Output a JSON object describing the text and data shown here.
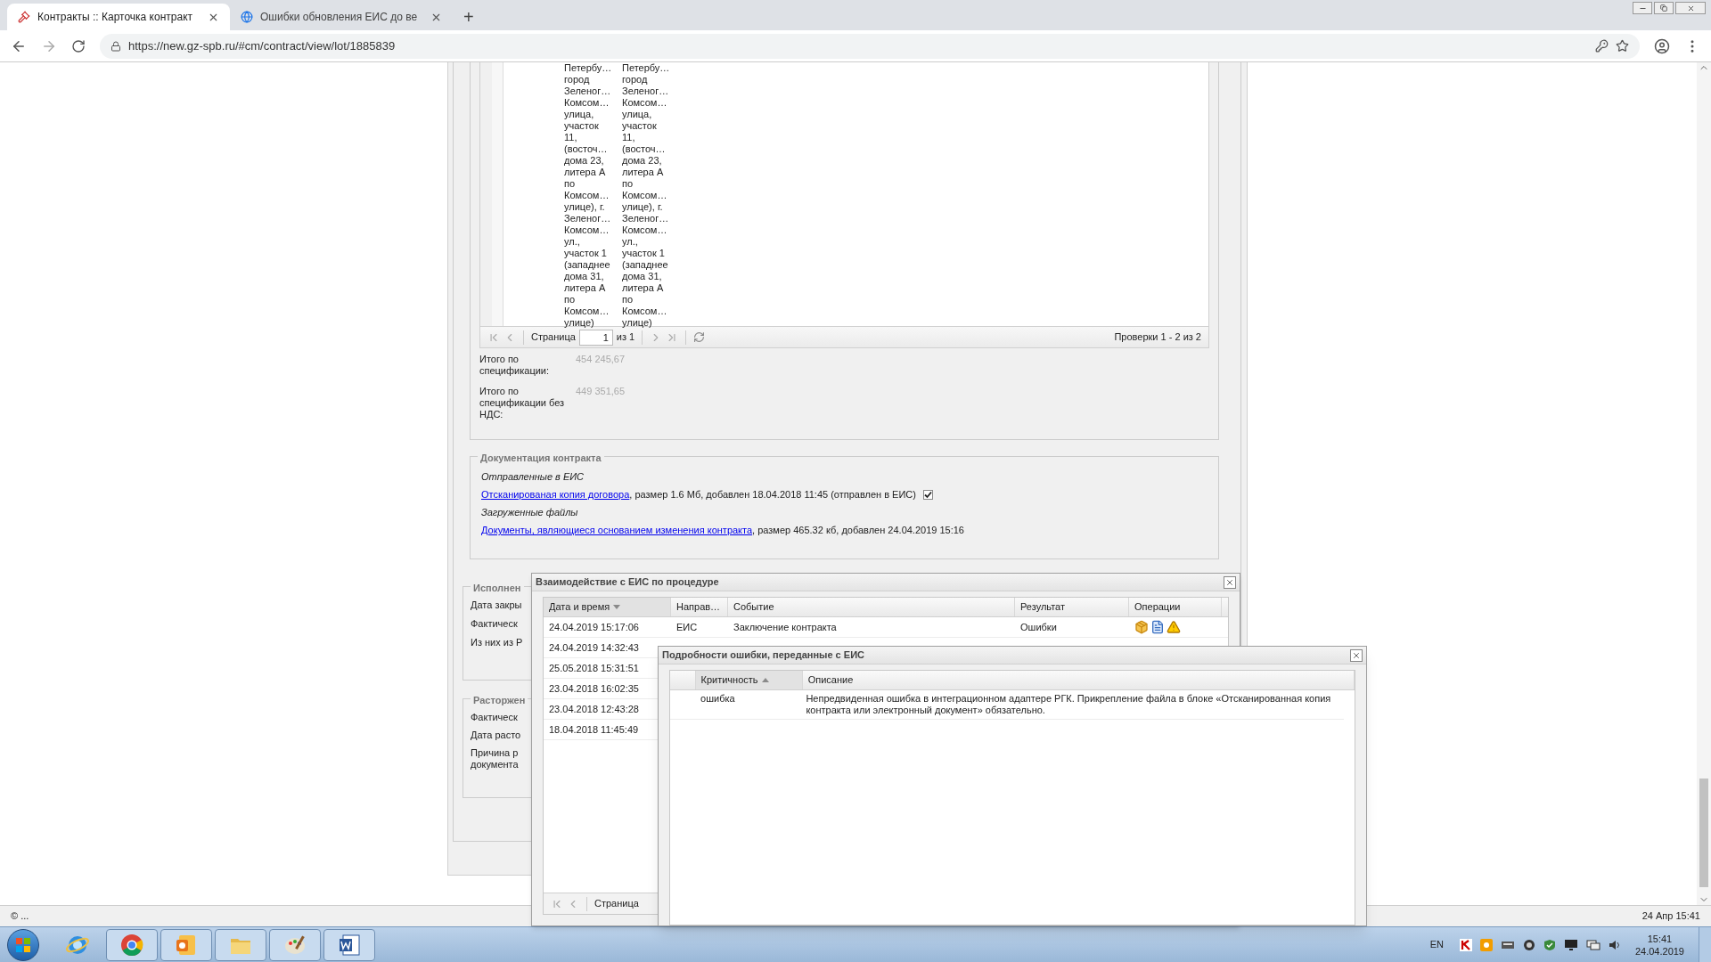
{
  "browser": {
    "tabs": [
      {
        "title": "Контракты :: Карточка контракт",
        "selected": true
      },
      {
        "title": "Ошибки обновления ЕИС до ве",
        "selected": false
      }
    ],
    "new_tab": "+",
    "url": "https://new.gz-spb.ru/#cm/contract/view/lot/1885839"
  },
  "spec_grid": {
    "cells": [
      {
        "text": "Петербу…\nгород\nЗеленог…\nКомсом…\nулица,\nучасток\n11,\n(восточ…\nдома 23,\nлитера А\nпо\nКомсом…\nулице), г.\nЗеленог…\nКомсом…\nул.,\nучасток 1\n(западнее\nдома 31,\nлитера А\nпо\nКомсом…\nулице)"
      },
      {
        "text": "Петербу…\nгород\nЗеленог…\nКомсом…\nулица,\nучасток\n11,\n(восточ…\nдома 23,\nлитера А\nпо\nКомсом…\nулице), г.\nЗеленог…\nКомсом…\nул.,\nучасток 1\n(западнее\nдома 31,\nлитера А\nпо\nКомсом…\nулице)"
      }
    ],
    "pager": {
      "page_label": "Страница",
      "page": "1",
      "of": "из 1",
      "summary": "Проверки 1 - 2 из 2"
    }
  },
  "totals": [
    {
      "label": "Итого по спецификации:",
      "value": "454 245,67"
    },
    {
      "label": "Итого по спецификации без НДС:",
      "value": "449 351,65"
    }
  ],
  "documentation": {
    "legend": "Документация контракта",
    "groups": [
      {
        "heading": "Отправленные в ЕИС",
        "files": [
          {
            "link": "Отсканированая копия договора",
            "details": ", размер 1.6 Мб, добавлен 18.04.2018 11:45 (отправлен в ЕИС)",
            "sent": true
          }
        ]
      },
      {
        "heading": "Загруженные файлы",
        "files": [
          {
            "link": "Документы, являющиеся основанием изменения контракта",
            "details": ", размер 465.32 кб, добавлен 24.04.2019 15:16"
          }
        ]
      }
    ]
  },
  "execution": {
    "legend": "Исполнен",
    "labels": [
      "Дата закры",
      "Фактическ",
      "Из них из Р"
    ]
  },
  "termination": {
    "legend": "Расторжен",
    "labels": [
      "Фактическ",
      "Дата расто",
      "Причина р\nдокумента"
    ]
  },
  "eis_dialog": {
    "title": "Взаимодействие с ЕИС по процедуре",
    "columns": [
      {
        "label": "Дата и время",
        "sorted": true,
        "ascending": false
      },
      {
        "label": "Направ…",
        "sorted": false
      },
      {
        "label": "Событие",
        "sorted": false
      },
      {
        "label": "Результат",
        "sorted": false
      },
      {
        "label": "Операции",
        "sorted": false
      }
    ],
    "rows": [
      {
        "date": "24.04.2019 15:17:06",
        "direction": "ЕИС",
        "event": "Заключение контракта",
        "result": "Ошибки"
      },
      {
        "date": "24.04.2019 14:32:43"
      },
      {
        "date": "25.05.2018 15:31:51"
      },
      {
        "date": "23.04.2018 16:02:35"
      },
      {
        "date": "23.04.2018 12:43:28"
      },
      {
        "date": "18.04.2018 11:45:49"
      }
    ],
    "pager": {
      "page_label": "Страница"
    }
  },
  "error_dialog": {
    "title": "Подробности ошибки, переданные с ЕИС",
    "columns": [
      {
        "label": "Критичность",
        "sorted": true,
        "ascending": true
      },
      {
        "label": "Описание",
        "sorted": false
      }
    ],
    "rows": [
      {
        "severity": "ошибка",
        "description": "Непредвиденная ошибка в интеграционном адаптере РГК. Прикрепление файла в блоке «Отсканированная копия контракта или электронный документ» обязательно."
      }
    ]
  },
  "status_bar": {
    "left": "© ...",
    "right": "24 Апр 15:41"
  },
  "taskbar": {
    "language": "EN",
    "time": "15:41",
    "date": "24.04.2019"
  }
}
